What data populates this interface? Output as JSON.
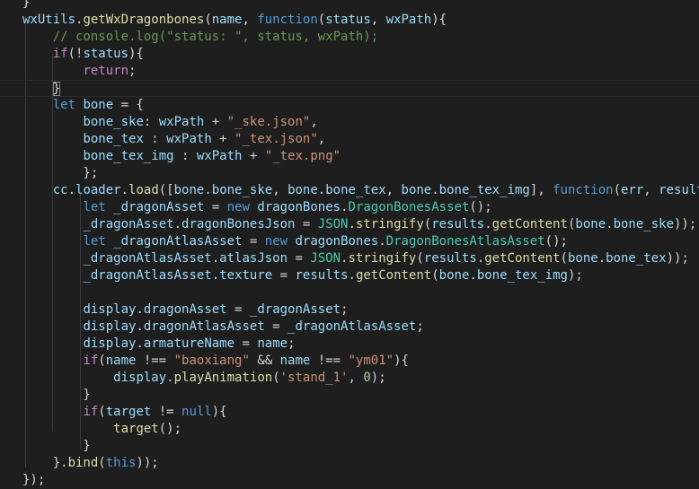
{
  "editor": {
    "language": "javascript",
    "theme_background": "#1e1e1e",
    "lines": [
      {
        "tokens": [
          [
            "p",
            "}"
          ]
        ]
      },
      {
        "tokens": [
          [
            "v",
            "wxUtils"
          ],
          [
            "p",
            "."
          ],
          [
            "f",
            "getWxDragonbones"
          ],
          [
            "p",
            "("
          ],
          [
            "v",
            "name"
          ],
          [
            "p",
            ", "
          ],
          [
            "k",
            "function"
          ],
          [
            "p",
            "("
          ],
          [
            "v",
            "status"
          ],
          [
            "p",
            ", "
          ],
          [
            "v",
            "wxPath"
          ],
          [
            "p",
            "){"
          ]
        ]
      },
      {
        "tokens": [
          [
            "p",
            "    "
          ],
          [
            "cm",
            "// console.log(\"status: \", status, wxPath);"
          ]
        ]
      },
      {
        "tokens": [
          [
            "p",
            "    "
          ],
          [
            "c",
            "if"
          ],
          [
            "p",
            "(!"
          ],
          [
            "v",
            "status"
          ],
          [
            "p",
            "){"
          ]
        ]
      },
      {
        "tokens": [
          [
            "p",
            "        "
          ],
          [
            "c",
            "return"
          ],
          [
            "p",
            ";"
          ]
        ]
      },
      {
        "tokens": [
          [
            "p",
            "    "
          ],
          [
            "p",
            "}",
            "bracket-match"
          ]
        ],
        "current": true
      },
      {
        "tokens": [
          [
            "p",
            "    "
          ],
          [
            "k",
            "let"
          ],
          [
            "p",
            " "
          ],
          [
            "v",
            "bone"
          ],
          [
            "p",
            " = {"
          ]
        ]
      },
      {
        "tokens": [
          [
            "p",
            "        "
          ],
          [
            "v",
            "bone_ske"
          ],
          [
            "p",
            ": "
          ],
          [
            "v",
            "wxPath"
          ],
          [
            "p",
            " + "
          ],
          [
            "s",
            "\"_ske.json\""
          ],
          [
            "p",
            ","
          ]
        ]
      },
      {
        "tokens": [
          [
            "p",
            "        "
          ],
          [
            "v",
            "bone_tex"
          ],
          [
            "p",
            " : "
          ],
          [
            "v",
            "wxPath"
          ],
          [
            "p",
            " + "
          ],
          [
            "s",
            "\"_tex.json\""
          ],
          [
            "p",
            ","
          ]
        ]
      },
      {
        "tokens": [
          [
            "p",
            "        "
          ],
          [
            "v",
            "bone_tex_img"
          ],
          [
            "p",
            " : "
          ],
          [
            "v",
            "wxPath"
          ],
          [
            "p",
            " + "
          ],
          [
            "s",
            "\"_tex.png\""
          ]
        ]
      },
      {
        "tokens": [
          [
            "p",
            "        };"
          ]
        ]
      },
      {
        "tokens": [
          [
            "p",
            "    "
          ],
          [
            "v",
            "cc"
          ],
          [
            "p",
            "."
          ],
          [
            "v",
            "loader"
          ],
          [
            "p",
            "."
          ],
          [
            "f",
            "load"
          ],
          [
            "p",
            "(["
          ],
          [
            "v",
            "bone"
          ],
          [
            "p",
            "."
          ],
          [
            "v",
            "bone_ske"
          ],
          [
            "p",
            ", "
          ],
          [
            "v",
            "bone"
          ],
          [
            "p",
            "."
          ],
          [
            "v",
            "bone_tex"
          ],
          [
            "p",
            ", "
          ],
          [
            "v",
            "bone"
          ],
          [
            "p",
            "."
          ],
          [
            "v",
            "bone_tex_img"
          ],
          [
            "p",
            "], "
          ],
          [
            "k",
            "function"
          ],
          [
            "p",
            "("
          ],
          [
            "v",
            "err"
          ],
          [
            "p",
            ", "
          ],
          [
            "v",
            "results"
          ],
          [
            "p",
            ") {"
          ]
        ]
      },
      {
        "tokens": [
          [
            "p",
            "        "
          ],
          [
            "k",
            "let"
          ],
          [
            "p",
            " "
          ],
          [
            "v",
            "_dragonAsset"
          ],
          [
            "p",
            " = "
          ],
          [
            "k",
            "new"
          ],
          [
            "p",
            " "
          ],
          [
            "v",
            "dragonBones"
          ],
          [
            "p",
            "."
          ],
          [
            "t",
            "DragonBonesAsset"
          ],
          [
            "p",
            "();"
          ]
        ]
      },
      {
        "tokens": [
          [
            "p",
            "        "
          ],
          [
            "v",
            "_dragonAsset"
          ],
          [
            "p",
            "."
          ],
          [
            "v",
            "dragonBonesJson"
          ],
          [
            "p",
            " = "
          ],
          [
            "t",
            "JSON"
          ],
          [
            "p",
            "."
          ],
          [
            "f",
            "stringify"
          ],
          [
            "p",
            "("
          ],
          [
            "v",
            "results"
          ],
          [
            "p",
            "."
          ],
          [
            "f",
            "getContent"
          ],
          [
            "p",
            "("
          ],
          [
            "v",
            "bone"
          ],
          [
            "p",
            "."
          ],
          [
            "v",
            "bone_ske"
          ],
          [
            "p",
            "));"
          ]
        ]
      },
      {
        "tokens": [
          [
            "p",
            "        "
          ],
          [
            "k",
            "let"
          ],
          [
            "p",
            " "
          ],
          [
            "v",
            "_dragonAtlasAsset"
          ],
          [
            "p",
            " = "
          ],
          [
            "k",
            "new"
          ],
          [
            "p",
            " "
          ],
          [
            "v",
            "dragonBones"
          ],
          [
            "p",
            "."
          ],
          [
            "t",
            "DragonBonesAtlasAsset"
          ],
          [
            "p",
            "();"
          ]
        ]
      },
      {
        "tokens": [
          [
            "p",
            "        "
          ],
          [
            "v",
            "_dragonAtlasAsset"
          ],
          [
            "p",
            "."
          ],
          [
            "v",
            "atlasJson"
          ],
          [
            "p",
            " = "
          ],
          [
            "t",
            "JSON"
          ],
          [
            "p",
            "."
          ],
          [
            "f",
            "stringify"
          ],
          [
            "p",
            "("
          ],
          [
            "v",
            "results"
          ],
          [
            "p",
            "."
          ],
          [
            "f",
            "getContent"
          ],
          [
            "p",
            "("
          ],
          [
            "v",
            "bone"
          ],
          [
            "p",
            "."
          ],
          [
            "v",
            "bone_tex"
          ],
          [
            "p",
            "));"
          ]
        ]
      },
      {
        "tokens": [
          [
            "p",
            "        "
          ],
          [
            "v",
            "_dragonAtlasAsset"
          ],
          [
            "p",
            "."
          ],
          [
            "v",
            "texture"
          ],
          [
            "p",
            " = "
          ],
          [
            "v",
            "results"
          ],
          [
            "p",
            "."
          ],
          [
            "f",
            "getContent"
          ],
          [
            "p",
            "("
          ],
          [
            "v",
            "bone"
          ],
          [
            "p",
            "."
          ],
          [
            "v",
            "bone_tex_img"
          ],
          [
            "p",
            ");"
          ]
        ]
      },
      {
        "tokens": []
      },
      {
        "tokens": [
          [
            "p",
            "        "
          ],
          [
            "v",
            "display"
          ],
          [
            "p",
            "."
          ],
          [
            "v",
            "dragonAsset"
          ],
          [
            "p",
            " = "
          ],
          [
            "v",
            "_dragonAsset"
          ],
          [
            "p",
            ";"
          ]
        ]
      },
      {
        "tokens": [
          [
            "p",
            "        "
          ],
          [
            "v",
            "display"
          ],
          [
            "p",
            "."
          ],
          [
            "v",
            "dragonAtlasAsset"
          ],
          [
            "p",
            " = "
          ],
          [
            "v",
            "_dragonAtlasAsset"
          ],
          [
            "p",
            ";"
          ]
        ]
      },
      {
        "tokens": [
          [
            "p",
            "        "
          ],
          [
            "v",
            "display"
          ],
          [
            "p",
            "."
          ],
          [
            "v",
            "armatureName"
          ],
          [
            "p",
            " = "
          ],
          [
            "v",
            "name"
          ],
          [
            "p",
            ";"
          ]
        ]
      },
      {
        "tokens": [
          [
            "p",
            "        "
          ],
          [
            "c",
            "if"
          ],
          [
            "p",
            "("
          ],
          [
            "v",
            "name"
          ],
          [
            "p",
            " !== "
          ],
          [
            "s",
            "\"baoxiang\""
          ],
          [
            "p",
            " && "
          ],
          [
            "v",
            "name"
          ],
          [
            "p",
            " !== "
          ],
          [
            "s",
            "\"ym01\""
          ],
          [
            "p",
            "){"
          ]
        ]
      },
      {
        "tokens": [
          [
            "p",
            "            "
          ],
          [
            "v",
            "display"
          ],
          [
            "p",
            "."
          ],
          [
            "f",
            "playAnimation"
          ],
          [
            "p",
            "("
          ],
          [
            "s",
            "'stand_1'"
          ],
          [
            "p",
            ", "
          ],
          [
            "n",
            "0"
          ],
          [
            "p",
            ");"
          ]
        ]
      },
      {
        "tokens": [
          [
            "p",
            "        }"
          ]
        ]
      },
      {
        "tokens": [
          [
            "p",
            "        "
          ],
          [
            "c",
            "if"
          ],
          [
            "p",
            "("
          ],
          [
            "v",
            "target"
          ],
          [
            "p",
            " != "
          ],
          [
            "k",
            "null"
          ],
          [
            "p",
            "){"
          ]
        ]
      },
      {
        "tokens": [
          [
            "p",
            "            "
          ],
          [
            "f",
            "target"
          ],
          [
            "p",
            "();"
          ]
        ]
      },
      {
        "tokens": [
          [
            "p",
            "        }"
          ]
        ]
      },
      {
        "tokens": [
          [
            "p",
            "    }."
          ],
          [
            "f",
            "bind"
          ],
          [
            "p",
            "("
          ],
          [
            "k",
            "this"
          ],
          [
            "p",
            "));"
          ]
        ]
      },
      {
        "tokens": [
          [
            "p",
            "});"
          ]
        ]
      }
    ]
  }
}
